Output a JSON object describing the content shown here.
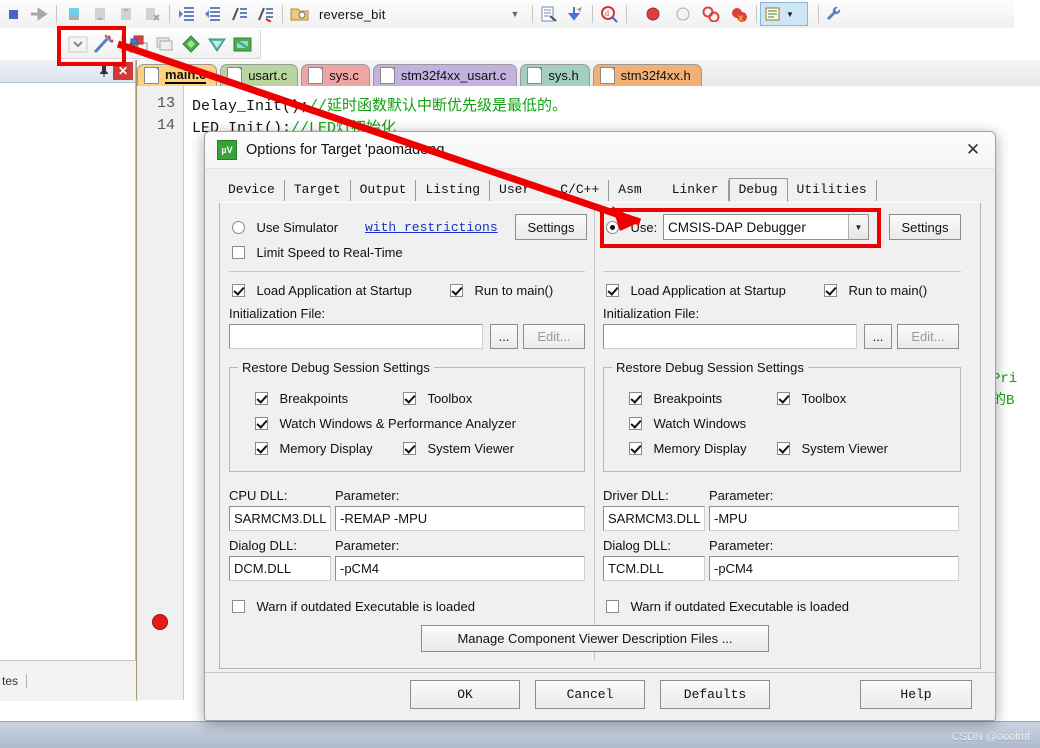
{
  "ide": {
    "project_name": "reverse_bit",
    "toolbar_icons": [
      "stop-icon",
      "step-forward-icon",
      "insert-bookmark-icon",
      "next-bookmark-icon",
      "previous-bookmark-icon",
      "clear-bookmarks-icon",
      "indent-icon",
      "outdent-icon",
      "comment-icon",
      "uncomment-icon",
      "open-folder-icon"
    ],
    "toolbar_icons_right": [
      "configure-icon",
      "download-icon",
      "find-in-files-icon",
      "insert-breakpoint-icon",
      "disable-breakpoint-icon",
      "kill-all-breakpoints-icon",
      "disable-all-breakpoints-icon",
      "project-window-icon",
      "utilities-icon"
    ],
    "toolbar2_icons": [
      "chevron-down-icon",
      "build-wizard-icon",
      "target-options-icon",
      "batch-build-icon",
      "translate-icon",
      "build-icon",
      "rebuild-icon"
    ],
    "pane": {
      "pin_label": "✔",
      "close_label": "✕",
      "status_text": "tes"
    },
    "editor_tabs": [
      {
        "label": "main.c",
        "color": "#ffd27f",
        "active": true
      },
      {
        "label": "usart.c",
        "color": "#b9d6a0",
        "active": false
      },
      {
        "label": "sys.c",
        "color": "#efa5a5",
        "active": false
      },
      {
        "label": "stm32f4xx_usart.c",
        "color": "#c3b1e0",
        "active": false
      },
      {
        "label": "sys.h",
        "color": "#a3cfc0",
        "active": false
      },
      {
        "label": "stm32f4xx.h",
        "color": "#f2b077",
        "active": false
      }
    ],
    "code": [
      {
        "no": "13",
        "code": "Delay_Init();",
        "comment": "//延时函数默认中断优先级是最低的。"
      },
      {
        "no": "14",
        "code": "LED_Init();",
        "comment": "//LED灯初始化"
      }
    ],
    "right_comment_lines": [
      "的Pri",
      "写的B"
    ],
    "watermark": "CSDN @ooolmf"
  },
  "dialog": {
    "title": "Options for Target 'paomadeng",
    "icon": "keil-uvision-icon",
    "close_label": "✕",
    "tabs": [
      {
        "label": "Device",
        "selected": false
      },
      {
        "label": "Target",
        "selected": false
      },
      {
        "label": "Output",
        "selected": false
      },
      {
        "label": "Listing",
        "selected": false
      },
      {
        "label": "User",
        "selected": false
      },
      {
        "label": "C/C++",
        "selected": false
      },
      {
        "label": "Asm",
        "selected": false
      },
      {
        "label": "Linker",
        "selected": false
      },
      {
        "label": "Debug",
        "selected": true
      },
      {
        "label": "Utilities",
        "selected": false
      }
    ],
    "left": {
      "radio_label": "Use Simulator",
      "radio_selected": false,
      "restrictions_link": "with restrictions",
      "settings_button": "Settings",
      "limit_speed_label": "Limit Speed to Real-Time",
      "limit_speed_checked": false,
      "load_app_label": "Load Application at Startup",
      "load_app_checked": true,
      "run_to_main_label": "Run to main()",
      "run_to_main_checked": true,
      "init_file_label": "Initialization File:",
      "init_file_value": "",
      "browse_button": "...",
      "edit_button": "Edit...",
      "restore_legend": "Restore Debug Session Settings",
      "restore_items": [
        {
          "label": "Breakpoints",
          "checked": true
        },
        {
          "label": "Toolbox",
          "checked": true
        },
        {
          "label": "Watch Windows & Performance Analyzer",
          "checked": true
        },
        {
          "label": "Memory Display",
          "checked": true
        },
        {
          "label": "System Viewer",
          "checked": true
        }
      ],
      "dll_label": "CPU DLL:",
      "dll_value": "SARMCM3.DLL",
      "dll_param_label": "Parameter:",
      "dll_param_value": "-REMAP -MPU",
      "dialog_dll_label": "Dialog DLL:",
      "dialog_dll_value": "DCM.DLL",
      "dialog_param_label": "Parameter:",
      "dialog_param_value": "-pCM4",
      "warn_label": "Warn if outdated Executable is loaded",
      "warn_checked": false
    },
    "right": {
      "radio_label": "Use:",
      "radio_selected": true,
      "debugger_value": "CMSIS-DAP Debugger",
      "settings_button": "Settings",
      "load_app_label": "Load Application at Startup",
      "load_app_checked": true,
      "run_to_main_label": "Run to main()",
      "run_to_main_checked": true,
      "init_file_label": "Initialization File:",
      "init_file_value": "",
      "browse_button": "...",
      "edit_button": "Edit...",
      "restore_legend": "Restore Debug Session Settings",
      "restore_items": [
        {
          "label": "Breakpoints",
          "checked": true
        },
        {
          "label": "Toolbox",
          "checked": true
        },
        {
          "label": "Watch Windows",
          "checked": true
        },
        {
          "label": "Memory Display",
          "checked": true
        },
        {
          "label": "System Viewer",
          "checked": true
        }
      ],
      "dll_label": "Driver DLL:",
      "dll_value": "SARMCM3.DLL",
      "dll_param_label": "Parameter:",
      "dll_param_value": "-MPU",
      "dialog_dll_label": "Dialog DLL:",
      "dialog_dll_value": "TCM.DLL",
      "dialog_param_label": "Parameter:",
      "dialog_param_value": "-pCM4",
      "warn_label": "Warn if outdated Executable is loaded",
      "warn_checked": false
    },
    "manage_button": "Manage Component Viewer Description Files ...",
    "buttons": {
      "ok": "OK",
      "cancel": "Cancel",
      "defaults": "Defaults",
      "help": "Help"
    }
  },
  "annotations": {
    "highlight_color": "#ef0000",
    "boxes": [
      "toolbar-target-options-box",
      "use-debugger-box"
    ],
    "arrow": "red-arrow-pointing-to-debugger-dropdown"
  }
}
